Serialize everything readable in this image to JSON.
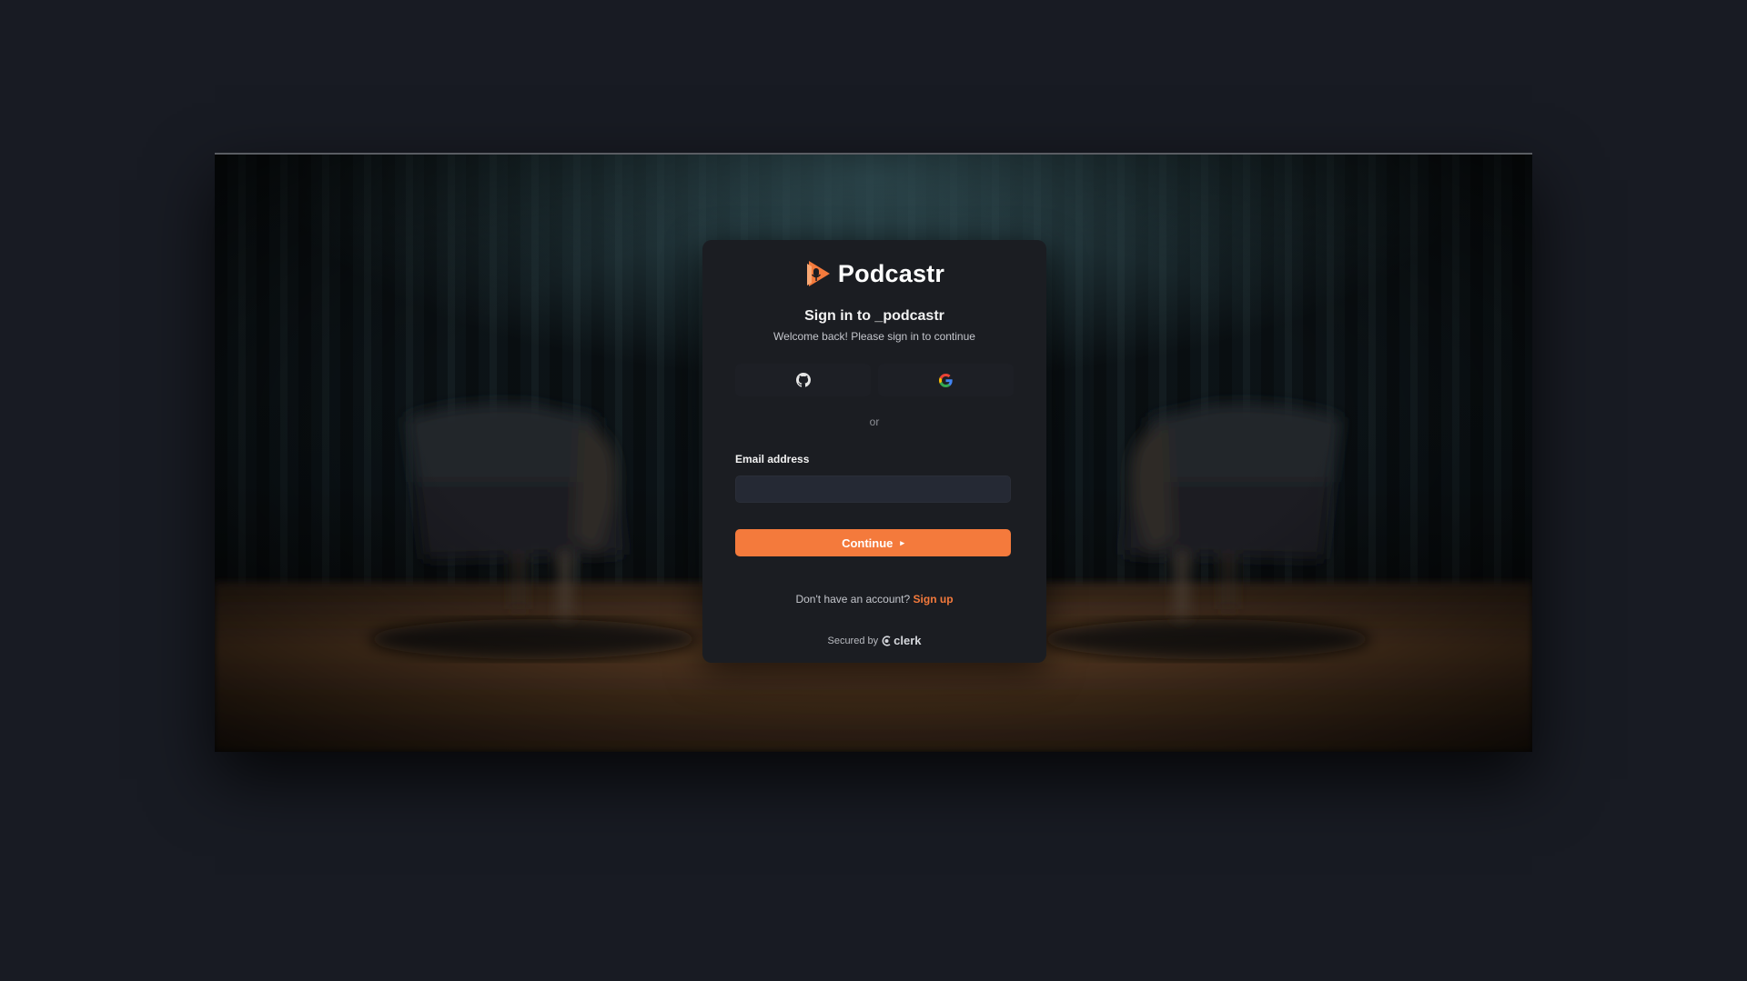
{
  "brand": {
    "name": "Podcastr",
    "logo_icon": "podcastr-logo-icon",
    "accent_color": "#f47a3c"
  },
  "signin": {
    "title": "Sign in to _podcastr",
    "subtitle": "Welcome back! Please sign in to continue",
    "social_buttons": [
      {
        "provider": "GitHub",
        "icon": "github-icon"
      },
      {
        "provider": "Google",
        "icon": "google-icon"
      }
    ],
    "divider": "or",
    "email_label": "Email address",
    "email_value": "",
    "email_placeholder": "",
    "continue_label": "Continue",
    "continue_icon": "caret-right-icon",
    "no_account_text": "Don't have an account?",
    "signup_label": "Sign up",
    "secured_by": "Secured by",
    "secured_brand": "clerk"
  }
}
